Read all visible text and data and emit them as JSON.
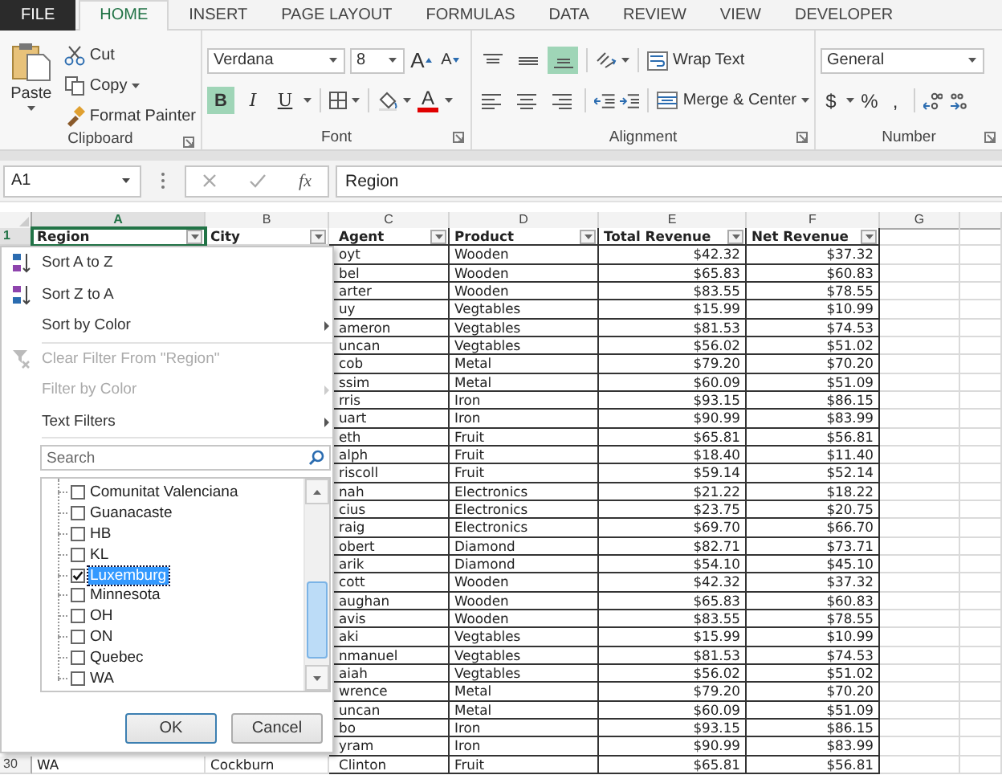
{
  "tabs": [
    {
      "label": "FILE",
      "kind": "file",
      "selected": false
    },
    {
      "label": "HOME",
      "kind": "tab",
      "selected": true
    },
    {
      "label": "INSERT",
      "kind": "tab",
      "selected": false
    },
    {
      "label": "PAGE LAYOUT",
      "kind": "tab",
      "selected": false
    },
    {
      "label": "FORMULAS",
      "kind": "tab",
      "selected": false
    },
    {
      "label": "DATA",
      "kind": "tab",
      "selected": false
    },
    {
      "label": "REVIEW",
      "kind": "tab",
      "selected": false
    },
    {
      "label": "VIEW",
      "kind": "tab",
      "selected": false
    },
    {
      "label": "DEVELOPER",
      "kind": "tab",
      "selected": false
    }
  ],
  "ribbon": {
    "clipboard": {
      "title": "Clipboard",
      "paste": "Paste",
      "cut": "Cut",
      "copy": "Copy",
      "format_painter": "Format Painter"
    },
    "font": {
      "title": "Font",
      "font_name": "Verdana",
      "font_size": "8",
      "grow": "A",
      "shrink": "A",
      "styles": [
        {
          "glyph": "B",
          "kind": "bold",
          "on": true
        },
        {
          "glyph": "I",
          "kind": "italic",
          "on": false
        },
        {
          "glyph": "U",
          "kind": "underline",
          "on": false
        }
      ],
      "font_color": {
        "glyph": "A",
        "color": "#e00000"
      }
    },
    "alignment": {
      "title": "Alignment",
      "vertical": [
        {
          "kind": "top",
          "selected": false
        },
        {
          "kind": "middle",
          "selected": false
        },
        {
          "kind": "bottom",
          "selected": true
        }
      ],
      "horizontal": [
        {
          "kind": "left",
          "selected": false
        },
        {
          "kind": "center",
          "selected": false
        },
        {
          "kind": "right",
          "selected": false
        }
      ],
      "wrap_text": "Wrap Text",
      "merge": "Merge & Center"
    },
    "number": {
      "title": "Number",
      "format": "General",
      "currency": "$",
      "percent": "%",
      "comma": ","
    }
  },
  "formula_bar": {
    "name_box": "A1",
    "function_label": "fx",
    "content": "Region"
  },
  "sheet": {
    "columns": [
      {
        "letter": "A",
        "selected": true
      },
      {
        "letter": "B",
        "selected": false
      },
      {
        "letter": "C",
        "selected": false
      },
      {
        "letter": "D",
        "selected": false
      },
      {
        "letter": "E",
        "selected": false
      },
      {
        "letter": "F",
        "selected": false
      },
      {
        "letter": "G",
        "selected": false
      }
    ],
    "header_row": {
      "number": "1",
      "cells": [
        "Region",
        "City",
        "Agent",
        "Product",
        "Total Revenue",
        "Net Revenue"
      ]
    },
    "rows": [
      {
        "agent": "oyt",
        "product": "Wooden",
        "total": "$42.32",
        "net": "$37.32"
      },
      {
        "agent": "bel",
        "product": "Wooden",
        "total": "$65.83",
        "net": "$60.83"
      },
      {
        "agent": "arter",
        "product": "Wooden",
        "total": "$83.55",
        "net": "$78.55"
      },
      {
        "agent": "uy",
        "product": "Vegtables",
        "total": "$15.99",
        "net": "$10.99"
      },
      {
        "agent": "ameron",
        "product": "Vegtables",
        "total": "$81.53",
        "net": "$74.53"
      },
      {
        "agent": "uncan",
        "product": "Vegtables",
        "total": "$56.02",
        "net": "$51.02"
      },
      {
        "agent": "cob",
        "product": "Metal",
        "total": "$79.20",
        "net": "$70.20"
      },
      {
        "agent": "ssim",
        "product": "Metal",
        "total": "$60.09",
        "net": "$51.09"
      },
      {
        "agent": "rris",
        "product": "Iron",
        "total": "$93.15",
        "net": "$86.15"
      },
      {
        "agent": "uart",
        "product": "Iron",
        "total": "$90.99",
        "net": "$83.99"
      },
      {
        "agent": "eth",
        "product": "Fruit",
        "total": "$65.81",
        "net": "$56.81"
      },
      {
        "agent": "alph",
        "product": "Fruit",
        "total": "$18.40",
        "net": "$11.40"
      },
      {
        "agent": "riscoll",
        "product": "Fruit",
        "total": "$59.14",
        "net": "$52.14"
      },
      {
        "agent": "nah",
        "product": "Electronics",
        "total": "$21.22",
        "net": "$18.22"
      },
      {
        "agent": "cius",
        "product": "Electronics",
        "total": "$23.75",
        "net": "$20.75"
      },
      {
        "agent": "raig",
        "product": "Electronics",
        "total": "$69.70",
        "net": "$66.70"
      },
      {
        "agent": "obert",
        "product": "Diamond",
        "total": "$82.71",
        "net": "$73.71"
      },
      {
        "agent": "arik",
        "product": "Diamond",
        "total": "$54.10",
        "net": "$45.10"
      },
      {
        "agent": "cott",
        "product": "Wooden",
        "total": "$42.32",
        "net": "$37.32"
      },
      {
        "agent": "aughan",
        "product": "Wooden",
        "total": "$65.83",
        "net": "$60.83"
      },
      {
        "agent": "avis",
        "product": "Wooden",
        "total": "$83.55",
        "net": "$78.55"
      },
      {
        "agent": "aki",
        "product": "Vegtables",
        "total": "$15.99",
        "net": "$10.99"
      },
      {
        "agent": "nmanuel",
        "product": "Vegtables",
        "total": "$81.53",
        "net": "$74.53"
      },
      {
        "agent": "aiah",
        "product": "Vegtables",
        "total": "$56.02",
        "net": "$51.02"
      },
      {
        "agent": "wrence",
        "product": "Metal",
        "total": "$79.20",
        "net": "$70.20"
      },
      {
        "agent": "uncan",
        "product": "Metal",
        "total": "$60.09",
        "net": "$51.09"
      },
      {
        "agent": "bo",
        "product": "Iron",
        "total": "$93.15",
        "net": "$86.15"
      },
      {
        "agent": "yram",
        "product": "Iron",
        "total": "$90.99",
        "net": "$83.99"
      },
      {
        "number": "30",
        "region": "WA",
        "city": "Cockburn",
        "agent": "Clinton",
        "product": "Fruit",
        "total": "$65.81",
        "net": "$56.81"
      }
    ]
  },
  "filter_menu": {
    "items": [
      {
        "label": "Sort A to Z",
        "kind": "sort_asc",
        "disabled": false,
        "submenu": false
      },
      {
        "label": "Sort Z to A",
        "kind": "sort_desc",
        "disabled": false,
        "submenu": false
      },
      {
        "label": "Sort by Color",
        "kind": "plain",
        "disabled": false,
        "submenu": true
      },
      {
        "label": "Clear Filter From \"Region\"",
        "kind": "clear",
        "disabled": true,
        "submenu": false
      },
      {
        "label": "Filter by Color",
        "kind": "plain",
        "disabled": true,
        "submenu": true
      },
      {
        "label": "Text Filters",
        "kind": "plain",
        "disabled": false,
        "submenu": true
      }
    ],
    "search": {
      "placeholder": "Search"
    },
    "values": [
      {
        "label": "Comunitat Valenciana",
        "checked": false,
        "selected": false
      },
      {
        "label": "Guanacaste",
        "checked": false,
        "selected": false
      },
      {
        "label": "HB",
        "checked": false,
        "selected": false
      },
      {
        "label": "KL",
        "checked": false,
        "selected": false
      },
      {
        "label": "Luxemburg",
        "checked": true,
        "selected": true
      },
      {
        "label": "Minnesota",
        "checked": false,
        "selected": false
      },
      {
        "label": "OH",
        "checked": false,
        "selected": false
      },
      {
        "label": "ON",
        "checked": false,
        "selected": false
      },
      {
        "label": "Quebec",
        "checked": false,
        "selected": false
      },
      {
        "label": "WA",
        "checked": false,
        "selected": false
      }
    ],
    "buttons": [
      "OK",
      "Cancel"
    ]
  }
}
